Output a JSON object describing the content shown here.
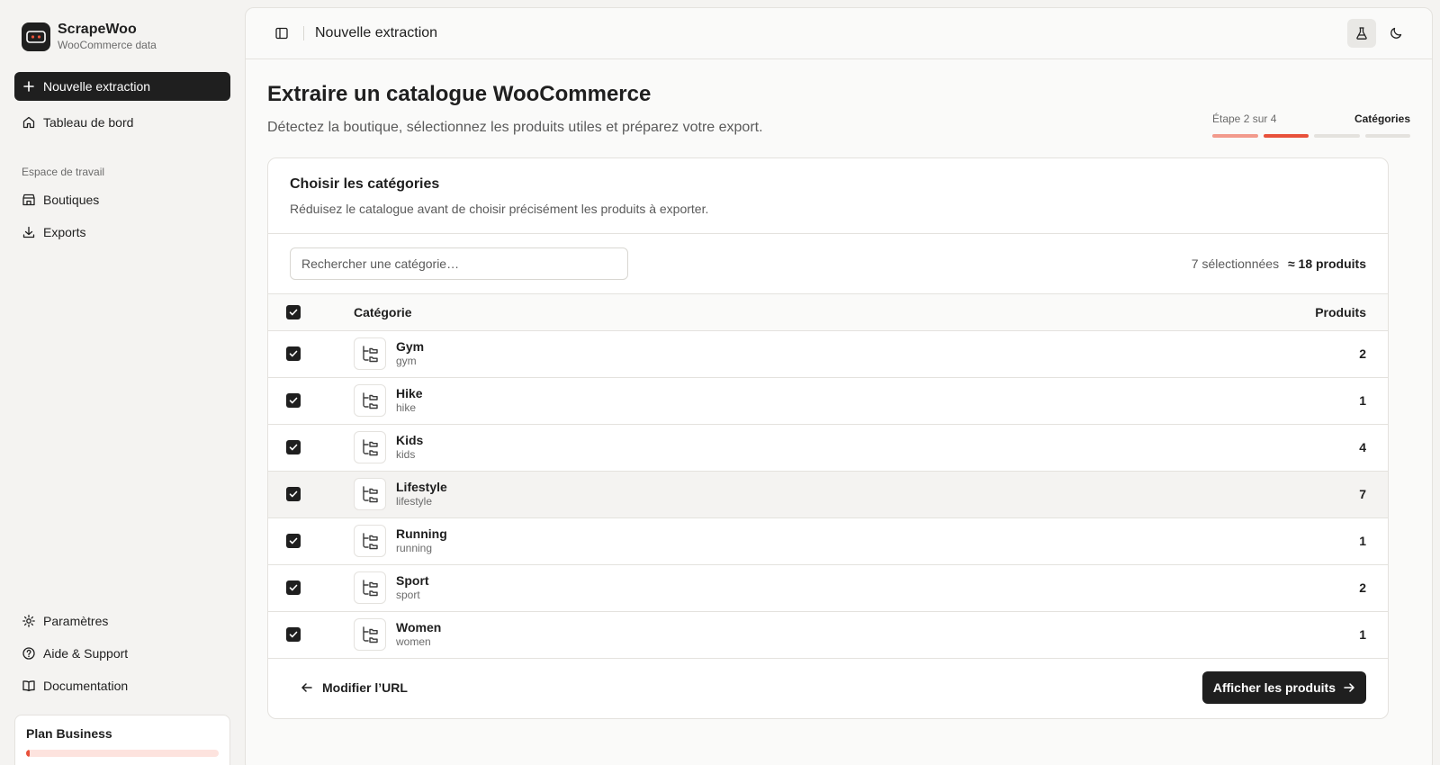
{
  "brand": {
    "name": "ScrapeWoo",
    "subtitle": "WooCommerce data"
  },
  "sidebar": {
    "primary_action": "Nouvelle extraction",
    "dashboard": "Tableau de bord",
    "section_label": "Espace de travail",
    "workspace_items": [
      "Boutiques",
      "Exports"
    ],
    "bottom_items": [
      "Paramètres",
      "Aide & Support",
      "Documentation"
    ],
    "plan": {
      "name": "Plan Business",
      "usage_fraction": 0.02
    }
  },
  "topbar": {
    "title": "Nouvelle extraction"
  },
  "page": {
    "title": "Extraire un catalogue WooCommerce",
    "subtitle": "Détectez la boutique, sélectionnez les produits utiles et préparez votre export."
  },
  "stepper": {
    "label": "Étape 2 sur 4",
    "current": "Catégories",
    "total_steps": 4,
    "current_step": 2
  },
  "card": {
    "title": "Choisir les catégories",
    "subtitle": "Réduisez le catalogue avant de choisir précisément les produits à exporter.",
    "search_placeholder": "Rechercher une catégorie…",
    "selected_text": "7 sélectionnées",
    "products_text": "≈ 18 produits",
    "columns": {
      "category": "Catégorie",
      "products": "Produits"
    },
    "rows": [
      {
        "name": "Gym",
        "slug": "gym",
        "count": "2"
      },
      {
        "name": "Hike",
        "slug": "hike",
        "count": "1"
      },
      {
        "name": "Kids",
        "slug": "kids",
        "count": "4"
      },
      {
        "name": "Lifestyle",
        "slug": "lifestyle",
        "count": "7"
      },
      {
        "name": "Running",
        "slug": "running",
        "count": "1"
      },
      {
        "name": "Sport",
        "slug": "sport",
        "count": "2"
      },
      {
        "name": "Women",
        "slug": "women",
        "count": "1"
      }
    ],
    "back_label": "Modifier l’URL",
    "next_label": "Afficher les produits"
  },
  "colors": {
    "accent": "#e8513b",
    "dark": "#1f1f1f",
    "border": "#e4e2de"
  }
}
